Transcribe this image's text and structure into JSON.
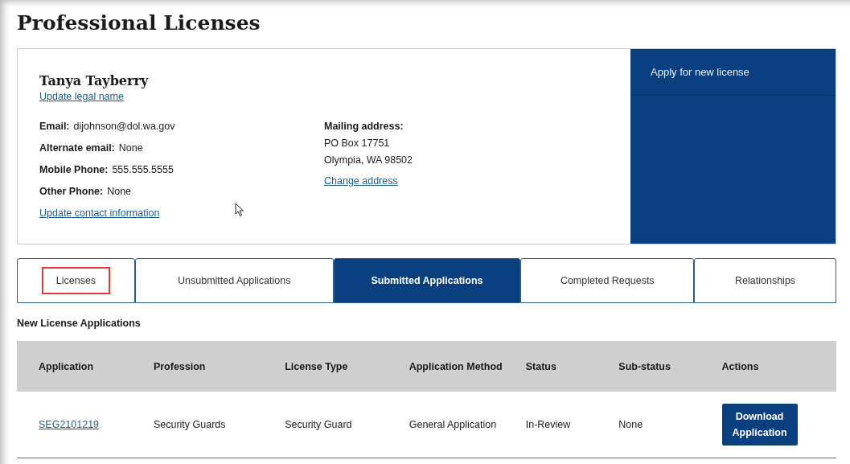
{
  "page": {
    "title": "Professional Licenses"
  },
  "profile": {
    "name": "Tanya Tayberry",
    "update_name_link": "Update legal name",
    "contacts": [
      {
        "label": "Email:",
        "value": "dijohnson@dol.wa.gov"
      },
      {
        "label": "Alternate email:",
        "value": "None"
      },
      {
        "label": "Mobile Phone:",
        "value": "555.555.5555"
      },
      {
        "label": "Other Phone:",
        "value": "None"
      }
    ],
    "update_contact_link": "Update contact information",
    "mailing": {
      "label": "Mailing address:",
      "lines": [
        "PO Box 17751",
        "Olympia, WA 98502"
      ],
      "change_link": "Change address"
    }
  },
  "side_panel": {
    "items": [
      "Apply for new license"
    ]
  },
  "tabs": [
    {
      "label": "Licenses",
      "selected": false,
      "highlighted": true
    },
    {
      "label": "Unsubmitted Applications",
      "selected": false,
      "highlighted": false
    },
    {
      "label": "Submitted Applications",
      "selected": true,
      "highlighted": false
    },
    {
      "label": "Completed Requests",
      "selected": false,
      "highlighted": false
    },
    {
      "label": "Relationships",
      "selected": false,
      "highlighted": false
    }
  ],
  "section": {
    "title": "New License Applications"
  },
  "table": {
    "columns": [
      "Application",
      "Profession",
      "License Type",
      "Application Method",
      "Status",
      "Sub-status",
      "Actions"
    ],
    "rows": [
      {
        "application": "SEG2101219",
        "profession": "Security Guards",
        "license_type": "Security Guard",
        "method": "General Application",
        "status": "In-Review",
        "sub_status": "None",
        "action": "Download Application"
      }
    ]
  }
}
